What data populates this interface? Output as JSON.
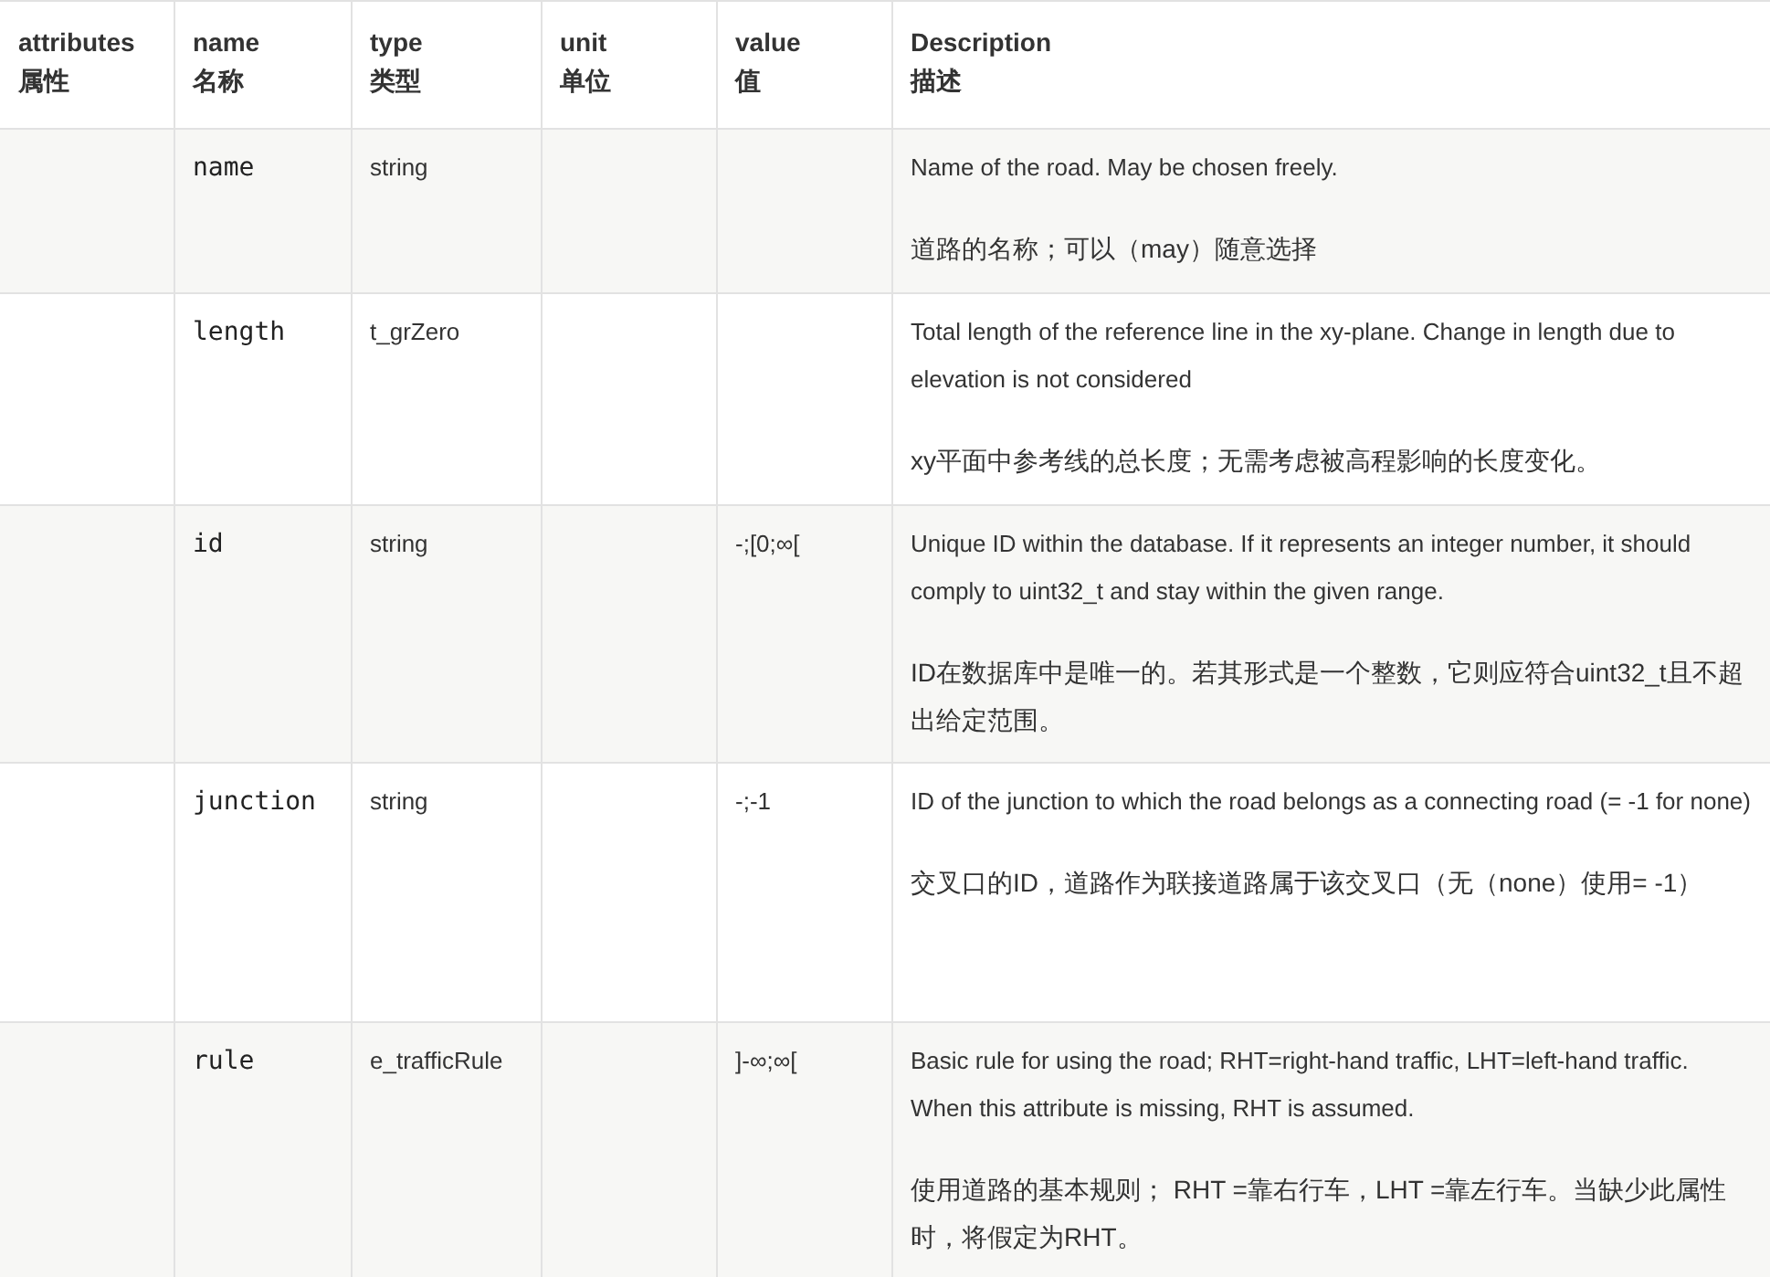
{
  "table": {
    "columns": [
      {
        "label": "attributes",
        "label_zh": "属性"
      },
      {
        "label": "name",
        "label_zh": "名称"
      },
      {
        "label": "type",
        "label_zh": "类型"
      },
      {
        "label": "unit",
        "label_zh": "单位"
      },
      {
        "label": "value",
        "label_zh": "值"
      },
      {
        "label": "Description",
        "label_zh": "描述"
      }
    ],
    "rows": [
      {
        "name": "name",
        "type": "string",
        "description": [
          "Name of the road. May be chosen freely.",
          "道路的名称；可以（may）随意选择"
        ]
      },
      {
        "name": "length",
        "type": "t_grZero",
        "description": [
          "Total length of the reference line in the xy-plane. Change in length due to elevation is not considered",
          "xy平面中参考线的总长度；无需考虑被高程影响的长度变化。"
        ]
      },
      {
        "name": "id",
        "type": "string",
        "value": "-;[0;∞[",
        "description": [
          "Unique ID within the database. If it represents an integer number, it should comply to uint32_t and stay within the given range.",
          "ID在数据库中是唯一的。若其形式是一个整数，它则应符合uint32_t且不超出给定范围。"
        ]
      },
      {
        "name": "junction",
        "type": "string",
        "value": "-;-1",
        "description": [
          "ID of the junction to which the road belongs as a connecting road (= -1 for none)",
          "交叉口的ID，道路作为联接道路属于该交叉口（无（none）使用= -1）"
        ]
      },
      {
        "name": "rule",
        "type": "e_trafficRule",
        "value": "]-∞;∞[",
        "description": [
          "Basic rule for using the road; RHT=right-hand traffic, LHT=left-hand traffic. When this attribute is missing, RHT is assumed.",
          "使用道路的基本规则； RHT =靠右行车，LHT =靠左行车。当缺少此属性时，将假定为RHT。"
        ]
      }
    ]
  }
}
